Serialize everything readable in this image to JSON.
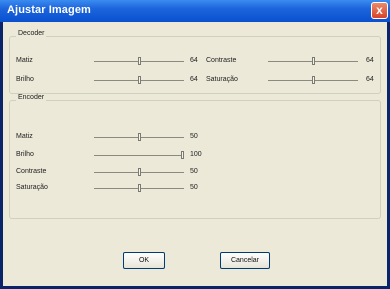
{
  "window": {
    "title": "Ajustar Imagem",
    "close_label": "x"
  },
  "decoder": {
    "label": "Decoder",
    "rows": [
      {
        "label": "Matiz",
        "value": "64",
        "level": 0.5
      },
      {
        "label": "Brilho",
        "value": "64",
        "level": 0.5
      },
      {
        "label": "Contraste",
        "value": "64",
        "level": 0.5
      },
      {
        "label": "Saturação",
        "value": "64",
        "level": 0.5
      }
    ]
  },
  "encoder": {
    "label": "Encoder",
    "rows": [
      {
        "label": "Matiz",
        "value": "50",
        "level": 0.5
      },
      {
        "label": "Brilho",
        "value": "100",
        "level": 1.0
      },
      {
        "label": "Contraste",
        "value": "50",
        "level": 0.5
      },
      {
        "label": "Saturação",
        "value": "50",
        "level": 0.5
      }
    ]
  },
  "buttons": {
    "ok": "OK",
    "cancel": "Cancelar"
  }
}
